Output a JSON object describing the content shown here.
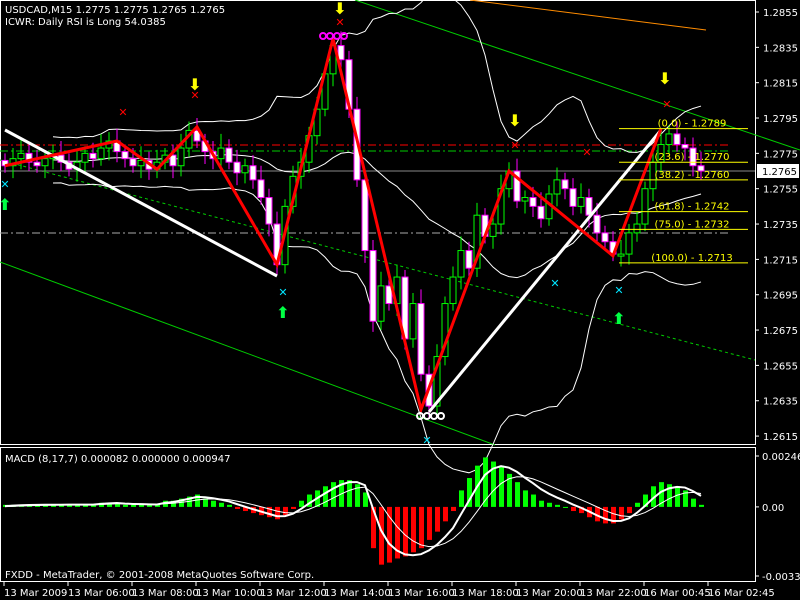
{
  "header": {
    "symbol_line": "USDCAD,M15  1.2775 1.2775 1.2765 1.2765",
    "indicator_line": "ICWR: Daily RSI is Long 54.0385"
  },
  "footer": {
    "copyright": "FXDD - MetaTrader, © 2001-2008 MetaQuotes Software Corp."
  },
  "colors": {
    "bull": "#00ff00",
    "bear": "#ff00ff",
    "zigzag": "#ff0000",
    "fib": "#ffff00",
    "channel": "#00cc00",
    "macd_pos": "#00ff00",
    "macd_neg": "#ff0000"
  },
  "chart_data": [
    {
      "type": "candlestick",
      "title": "USDCAD,M15",
      "ylim": [
        1.2605,
        1.2865
      ],
      "price_ticks": [
        "1.2855",
        "1.2835",
        "1.2815",
        "1.2795",
        "1.2775",
        "1.2755",
        "1.2735",
        "1.2715",
        "1.2695",
        "1.2675",
        "1.2655",
        "1.2635",
        "1.2615"
      ],
      "current_price": "1.2765",
      "time_ticks": [
        "13 Mar 2009",
        "13 Mar 06:00",
        "13 Mar 08:00",
        "13 Mar 10:00",
        "13 Mar 12:00",
        "13 Mar 14:00",
        "13 Mar 16:00",
        "13 Mar 18:00",
        "13 Mar 20:00",
        "13 Mar 22:00",
        "16 Mar 00:45",
        "16 Mar 02:45"
      ],
      "closes": [
        1.2768,
        1.2772,
        1.2775,
        1.277,
        1.2768,
        1.2772,
        1.2774,
        1.277,
        1.2766,
        1.277,
        1.2775,
        1.2772,
        1.2778,
        1.2782,
        1.2776,
        1.2772,
        1.2768,
        1.2771,
        1.2766,
        1.277,
        1.2774,
        1.2768,
        1.2778,
        1.2788,
        1.2782,
        1.2776,
        1.2772,
        1.2778,
        1.277,
        1.2764,
        1.2768,
        1.276,
        1.275,
        1.2735,
        1.2712,
        1.2745,
        1.2762,
        1.277,
        1.2785,
        1.28,
        1.282,
        1.2836,
        1.2828,
        1.28,
        1.276,
        1.272,
        1.268,
        1.27,
        1.269,
        1.2705,
        1.267,
        1.269,
        1.265,
        1.2632,
        1.266,
        1.269,
        1.2705,
        1.272,
        1.271,
        1.274,
        1.2728,
        1.2735,
        1.2755,
        1.2765,
        1.2748,
        1.275,
        1.2745,
        1.2738,
        1.2752,
        1.276,
        1.2755,
        1.2745,
        1.275,
        1.274,
        1.273,
        1.2725,
        1.2718,
        1.2718,
        1.273,
        1.2735,
        1.2755,
        1.277,
        1.278,
        1.2786,
        1.278,
        1.2778,
        1.2768,
        1.2765
      ],
      "zigzag": [
        [
          0,
          1.2768
        ],
        [
          14,
          1.2782
        ],
        [
          19,
          1.2766
        ],
        [
          24,
          1.279
        ],
        [
          34,
          1.2712
        ],
        [
          41,
          1.284
        ],
        [
          52,
          1.263
        ],
        [
          63,
          1.2765
        ],
        [
          76,
          1.2717
        ],
        [
          82,
          1.2789
        ]
      ],
      "fib_levels": [
        {
          "label": "(0.0) - 1.2789",
          "price": 1.2789
        },
        {
          "label": "(23.6) - 1.2770",
          "price": 1.277
        },
        {
          "label": "(38.2) - 1.2760",
          "price": 1.276
        },
        {
          "label": "(61.8) - 1.2742",
          "price": 1.2742
        },
        {
          "label": "(75.0) - 1.2732",
          "price": 1.2732
        },
        {
          "label": "(100.0) - 1.2713",
          "price": 1.2713
        }
      ]
    },
    {
      "type": "bar",
      "title": "MACD",
      "legend": "MACD  (8,17,7) 0.000082 0.000000 0.000947",
      "ylim": [
        -0.00335,
        0.002468
      ],
      "y_ticks": [
        "0.002468",
        "0.00",
        "-0.00335"
      ],
      "histogram": [
        0.0001,
        0.0001,
        0.0001,
        0.0001,
        0.0001,
        0.0001,
        0.0001,
        0.0001,
        0.0001,
        0.0001,
        0.0001,
        0.0001,
        0.0002,
        0.0002,
        0.0002,
        0.0001,
        0.0001,
        0.0001,
        0.0001,
        0.0001,
        0.0003,
        0.0003,
        0.0004,
        0.0005,
        0.0006,
        0.0004,
        0.0003,
        0.0002,
        0.0001,
        -0.0001,
        -0.0002,
        -0.0003,
        -0.0004,
        -0.0005,
        -0.0006,
        -0.0004,
        -0.0001,
        0.0003,
        0.0006,
        0.0008,
        0.001,
        0.0012,
        0.0013,
        0.0013,
        0.0011,
        0.0007,
        -0.002,
        -0.0028,
        -0.0027,
        -0.0025,
        -0.0024,
        -0.0022,
        -0.002,
        -0.0016,
        -0.0012,
        -0.0007,
        -0.0002,
        0.0008,
        0.0014,
        0.002,
        0.0024,
        0.0022,
        0.002,
        0.0016,
        0.0012,
        0.0008,
        0.0006,
        0.0003,
        0.0002,
        0.0001,
        0.0,
        -0.0002,
        -0.0003,
        -0.0005,
        -0.0007,
        -0.0008,
        -0.0008,
        -0.0006,
        -0.0003,
        0.0002,
        0.0006,
        0.001,
        0.0012,
        0.0011,
        0.001,
        0.0008,
        0.0004,
        0.0001
      ]
    }
  ]
}
